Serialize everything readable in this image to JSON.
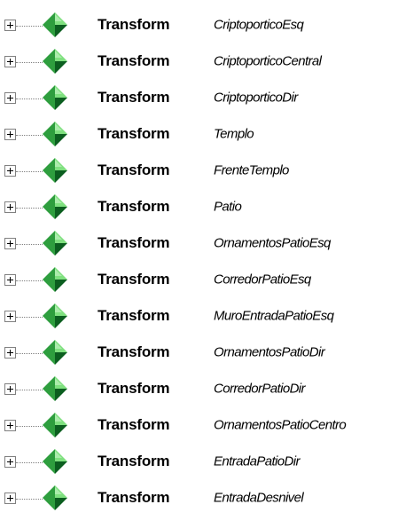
{
  "tree": {
    "icon": "green-diamond-transform-icon",
    "expander_icon": "plus-box-icon",
    "colors": {
      "diamond_light": "#7fe07f",
      "diamond_mid": "#2e9e3e",
      "diamond_dark": "#0b5e1f",
      "connector": "#808080"
    },
    "items": [
      {
        "type": "Transform",
        "name": "CriptoporticoEsq"
      },
      {
        "type": "Transform",
        "name": "CriptoporticoCentral"
      },
      {
        "type": "Transform",
        "name": "CriptoporticoDir"
      },
      {
        "type": "Transform",
        "name": "Templo"
      },
      {
        "type": "Transform",
        "name": "FrenteTemplo"
      },
      {
        "type": "Transform",
        "name": "Patio"
      },
      {
        "type": "Transform",
        "name": "OrnamentosPatioEsq"
      },
      {
        "type": "Transform",
        "name": "CorredorPatioEsq"
      },
      {
        "type": "Transform",
        "name": "MuroEntradaPatioEsq"
      },
      {
        "type": "Transform",
        "name": "OrnamentosPatioDir"
      },
      {
        "type": "Transform",
        "name": "CorredorPatioDir"
      },
      {
        "type": "Transform",
        "name": "OrnamentosPatioCentro"
      },
      {
        "type": "Transform",
        "name": "EntradaPatioDir"
      },
      {
        "type": "Transform",
        "name": "EntradaDesnivel"
      }
    ]
  }
}
